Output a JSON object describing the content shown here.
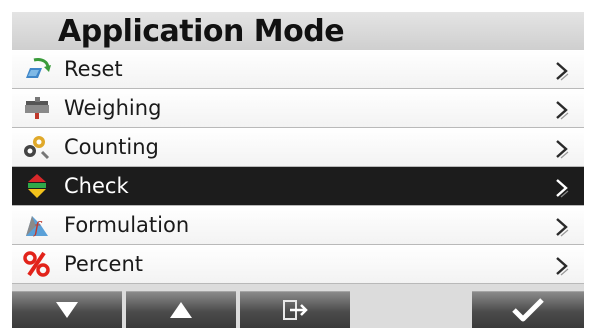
{
  "header": {
    "title": "Application Mode"
  },
  "menu": {
    "items": [
      {
        "label": "Reset",
        "icon": "reset-icon"
      },
      {
        "label": "Weighing",
        "icon": "weighing-icon"
      },
      {
        "label": "Counting",
        "icon": "counting-icon"
      },
      {
        "label": "Check",
        "icon": "check-weighing-icon",
        "selected": true
      },
      {
        "label": "Formulation",
        "icon": "formulation-icon"
      },
      {
        "label": "Percent",
        "icon": "percent-icon"
      }
    ]
  },
  "footer": {
    "buttons": [
      "down-arrow-icon",
      "up-arrow-icon",
      "exit-icon",
      "checkmark-icon"
    ]
  },
  "colors": {
    "selected_row": "#1c1c1c",
    "button": "#4b4b4b",
    "title_bar": "#d8d8d8"
  }
}
